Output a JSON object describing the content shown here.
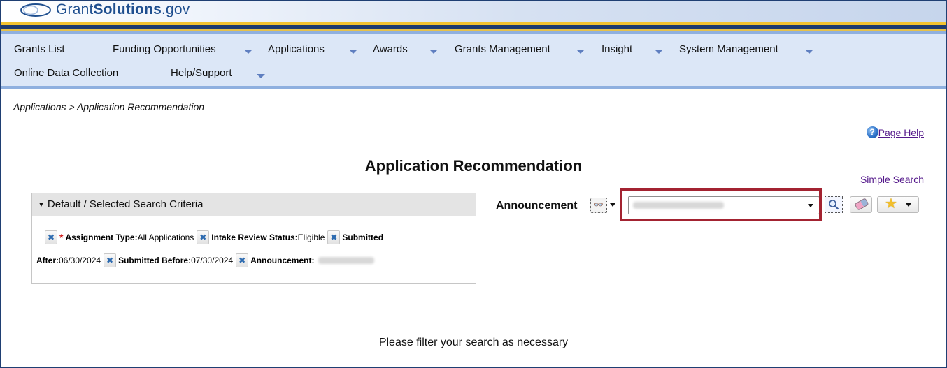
{
  "header": {
    "logo_prefix": "Grant",
    "logo_bold": "Solutions",
    "logo_suffix": ".gov"
  },
  "nav": {
    "items": [
      {
        "label": "Grants List",
        "has_dropdown": false
      },
      {
        "label": "Funding Opportunities",
        "has_dropdown": true
      },
      {
        "label": "Applications",
        "has_dropdown": true
      },
      {
        "label": "Awards",
        "has_dropdown": true
      },
      {
        "label": "Grants Management",
        "has_dropdown": true
      },
      {
        "label": "Insight",
        "has_dropdown": true
      },
      {
        "label": "System Management",
        "has_dropdown": true
      },
      {
        "label": "Online Data Collection",
        "has_dropdown": false
      },
      {
        "label": "Help/Support",
        "has_dropdown": true
      }
    ]
  },
  "breadcrumb": "Applications > Application Recommendation",
  "page_help": "Page Help",
  "page_title": "Application Recommendation",
  "simple_search": "Simple Search",
  "criteria": {
    "header": "Default / Selected Search Criteria",
    "items": [
      {
        "label": "Assignment Type:",
        "value": "All Applications",
        "required": true
      },
      {
        "label": "Intake Review Status:",
        "value": "Eligible",
        "required": false
      },
      {
        "label": "Submitted After:",
        "value": "06/30/2024",
        "required": false
      },
      {
        "label": "Submitted Before:",
        "value": "07/30/2024",
        "required": false
      },
      {
        "label": "Announcement:",
        "value": "",
        "required": false,
        "redacted": true
      }
    ]
  },
  "announcement": {
    "label": "Announcement",
    "selected_value": "",
    "redacted": true
  },
  "filter_message": "Please filter your search as necessary",
  "colors": {
    "highlight_box": "#a32331",
    "nav_background": "#dce7f7",
    "link": "#551a8b",
    "header_navy": "#1d3a6e",
    "header_yellow": "#f2c230"
  }
}
